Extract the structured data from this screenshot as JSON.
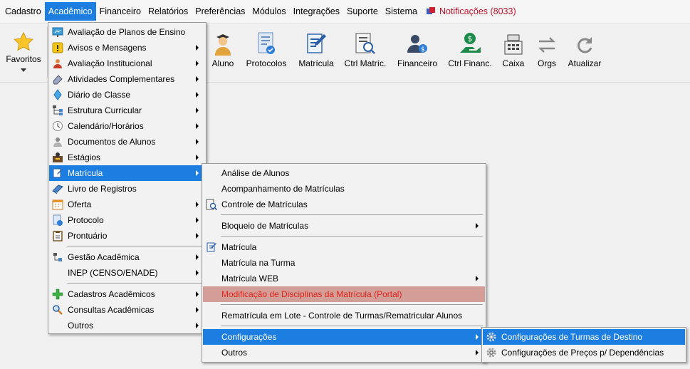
{
  "menubar": {
    "items": [
      "Cadastro",
      "Acadêmico",
      "Financeiro",
      "Relatórios",
      "Preferências",
      "Módulos",
      "Integrações",
      "Suporte",
      "Sistema"
    ],
    "notifications": "Notificações (8033)"
  },
  "toolbar": {
    "favorites": "Favoritos",
    "buttons": [
      "Aluno",
      "Protocolos",
      "Matrícula",
      "Ctrl Matríc.",
      "Financeiro",
      "Ctrl Financ.",
      "Caixa",
      "Orgs",
      "Atualizar"
    ]
  },
  "academico_menu": {
    "items": [
      "Avaliação de Planos de Ensino",
      "Avisos e Mensagens",
      "Avaliação Institucional",
      "Atividades Complementares",
      "Diário de Classe",
      "Estrutura Curricular",
      "Calendário/Horários",
      "Documentos de Alunos",
      "Estágios",
      "Matrícula",
      "Livro de Registros",
      "Oferta",
      "Protocolo",
      "Prontuário",
      "Gestão Acadêmica",
      "INEP (CENSO/ENADE)",
      "Cadastros Acadêmicos",
      "Consultas Acadêmicas",
      "Outros"
    ]
  },
  "matricula_menu": {
    "items": [
      "Análise de Alunos",
      "Acompanhamento de Matrículas",
      "Controle de Matrículas",
      "Bloqueio de Matrículas",
      "Matrícula",
      "Matrícula na Turma",
      "Matrícula WEB",
      "Modificação de Disciplinas da Matrícula (Portal)",
      "Rematrícula em Lote - Controle de Turmas/Rematricular Alunos",
      "Configurações",
      "Outros"
    ]
  },
  "config_menu": {
    "items": [
      "Configurações de Turmas de Destino",
      "Configurações de Preços p/ Dependências"
    ]
  },
  "colors": {
    "selection": "#1c7ee0",
    "disabled_bg": "#d49e98",
    "disabled_text": "#e0241c",
    "notification": "#c0142c"
  }
}
